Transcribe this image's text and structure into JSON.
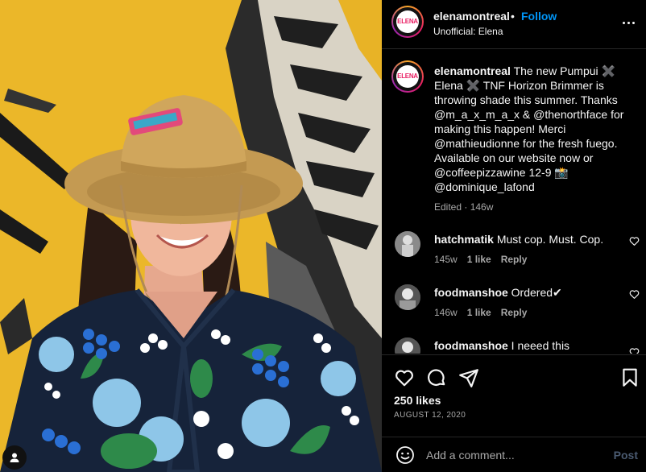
{
  "post": {
    "username": "elenamontreal",
    "follow_label": "Follow",
    "separator": "•",
    "subtitle": "Unofficial: Elena",
    "avatar_text": "ELENA"
  },
  "caption": {
    "username": "elenamontreal",
    "text": "The new Pumpui ✖️ Elena ✖️ TNF Horizon Brimmer is throwing shade this summer. Thanks @m_a_x_m_a_x & @thenorthface for making this happen! Merci @mathieudionne for the fresh fuego. Available on our website now or @coffeepizzawine 12-9 📸 @dominique_lafond",
    "meta": "Edited · 146w"
  },
  "comments": [
    {
      "username": "hatchmatik",
      "text": "Must cop. Must. Cop.",
      "age": "145w",
      "likes": "1 like",
      "reply": "Reply"
    },
    {
      "username": "foodmanshoe",
      "text": "Ordered✔",
      "age": "146w",
      "likes": "1 like",
      "reply": "Reply"
    },
    {
      "username": "foodmanshoe",
      "text": "I neeed this",
      "age": "",
      "likes": "",
      "reply": ""
    }
  ],
  "actions": {
    "likes": "250 likes",
    "date": "AUGUST 12, 2020",
    "icons": [
      "heart-icon",
      "comment-icon",
      "share-icon",
      "bookmark-icon"
    ]
  },
  "add_comment": {
    "placeholder": "Add a comment...",
    "post_label": "Post"
  },
  "colors": {
    "background": "#000000",
    "text": "#f5f5f5",
    "muted": "#a8a8a8",
    "follow": "#0095f6",
    "post_disabled": "#4a5a70",
    "divider": "#262626"
  }
}
